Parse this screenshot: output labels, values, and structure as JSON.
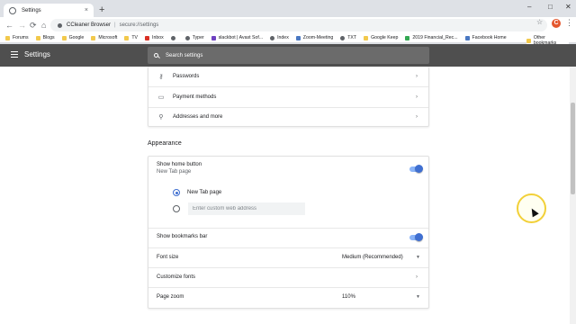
{
  "tab": {
    "title": "Settings",
    "close": "×",
    "new_tab": "+"
  },
  "window": {
    "minimize": "–",
    "maximize": "□",
    "close": "✕"
  },
  "toolbar": {
    "back": "←",
    "forward": "→",
    "reload": "⟳",
    "home": "⌂",
    "star": "☆",
    "menu": "⋮",
    "ext_label": "C"
  },
  "address": {
    "browser_name": "CCleaner Browser",
    "separator": "|",
    "url": "secure://settings"
  },
  "bookmarks": [
    {
      "label": "Forums",
      "icon": "folder"
    },
    {
      "label": "Blogs",
      "icon": "folder"
    },
    {
      "label": "Google",
      "icon": "folder"
    },
    {
      "label": "Microsoft",
      "icon": "folder"
    },
    {
      "label": "TV",
      "icon": "folder"
    },
    {
      "label": "Inbox",
      "icon": "mail"
    },
    {
      "label": "",
      "icon": "globe"
    },
    {
      "label": "Typer",
      "icon": "globe"
    },
    {
      "label": "slackbot | Avast Sof...",
      "icon": "slack"
    },
    {
      "label": "Index",
      "icon": "globe"
    },
    {
      "label": "Zoom-Meeting",
      "icon": "zoom"
    },
    {
      "label": "TXT",
      "icon": "globe"
    },
    {
      "label": "Google Keep",
      "icon": "keep"
    },
    {
      "label": "2019 Financial_Rec...",
      "icon": "doc"
    },
    {
      "label": "Facebook Home",
      "icon": "facebook"
    }
  ],
  "other_bookmarks": "Other bookmarks",
  "header": {
    "title": "Settings",
    "search_placeholder": "Search settings"
  },
  "autofill": {
    "passwords": "Passwords",
    "payment_methods": "Payment methods",
    "addresses": "Addresses and more"
  },
  "appearance": {
    "title": "Appearance",
    "show_home_button": "Show home button",
    "home_sub": "New Tab page",
    "home_enabled": true,
    "radio_newtab": "New Tab page",
    "custom_address_placeholder": "Enter custom web address",
    "show_bookmarks_bar": "Show bookmarks bar",
    "bookmarks_bar_enabled": true,
    "font_size_label": "Font size",
    "font_size_value": "Medium (Recommended)",
    "customize_fonts": "Customize fonts",
    "page_zoom_label": "Page zoom",
    "page_zoom_value": "110%"
  },
  "icons": {
    "chevron": "›",
    "caret": "▼",
    "key": "⚷",
    "card": "▭",
    "pin": "⚲"
  },
  "colors": {
    "header_bg": "#4f4f4f",
    "toggle_accent": "#3f6fd1"
  }
}
